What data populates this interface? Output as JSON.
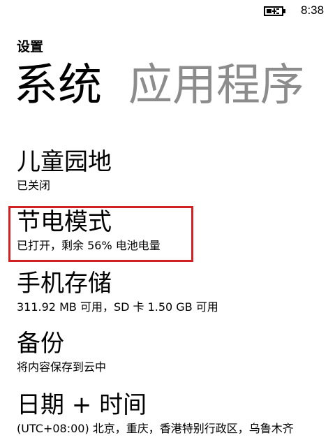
{
  "status_bar": {
    "battery_icon": "battery-charging-icon",
    "time": "8:38"
  },
  "header": {
    "title": "设置"
  },
  "pivot": {
    "active": "系统",
    "inactive": "应用程序"
  },
  "items": [
    {
      "title": "儿童园地",
      "subtitle": "已关闭"
    },
    {
      "title": "节电模式",
      "subtitle": "已打开，剩余 56% 电池电量"
    },
    {
      "title": "手机存储",
      "subtitle": "311.92 MB 可用，SD 卡 1.50 GB 可用"
    },
    {
      "title": "备份",
      "subtitle": "将内容保存到云中"
    },
    {
      "title": "日期 + 时间",
      "subtitle": "(UTC+08:00) 北京，重庆，香港特别行政区，乌鲁木齐"
    }
  ],
  "highlight_color": "#d02222"
}
